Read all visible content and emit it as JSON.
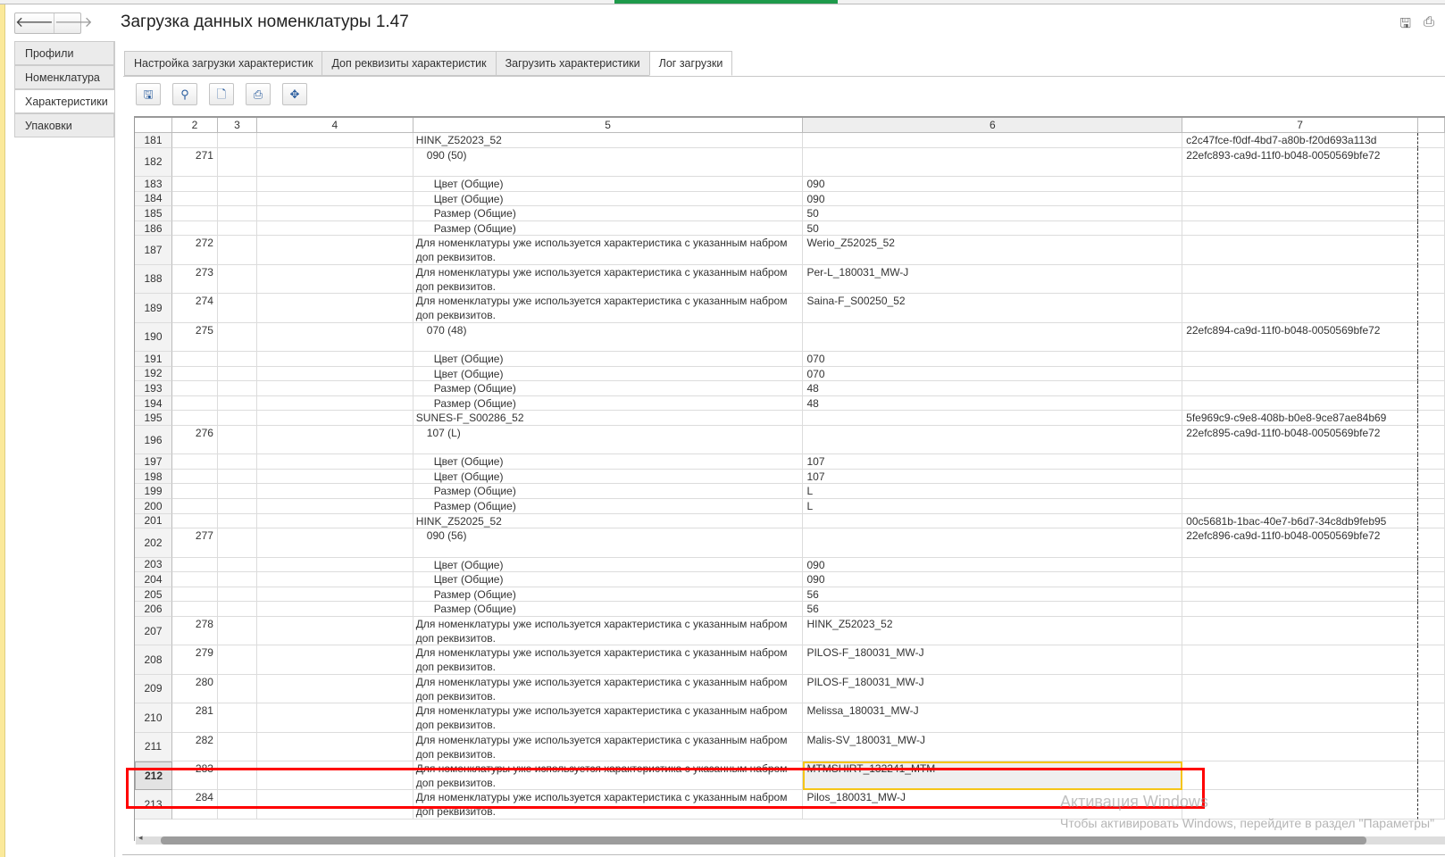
{
  "window": {
    "title": "Загрузка данных номенклатуры 1.47",
    "back": "🡐",
    "forward": "🡒"
  },
  "sidebar": {
    "items": [
      {
        "label": "Профили"
      },
      {
        "label": "Номенклатура"
      },
      {
        "label": "Характеристики"
      },
      {
        "label": "Упаковки"
      }
    ],
    "active": 2
  },
  "tabs": [
    {
      "label": "Настройка загрузки характеристик"
    },
    {
      "label": "Доп реквизиты характеристик"
    },
    {
      "label": "Загрузить характеристики"
    },
    {
      "label": "Лог загрузки"
    }
  ],
  "toolbar": {
    "icons": [
      "save-icon",
      "find-icon",
      "preview-icon",
      "print-icon",
      "move-icon"
    ]
  },
  "grid": {
    "headers": [
      "",
      "2",
      "3",
      "4",
      "5",
      "6",
      "7",
      ""
    ],
    "selected_row": "212",
    "rows": [
      {
        "n": "181",
        "c2": "",
        "c5": "HINK_Z52023_52",
        "i": 0,
        "c6": "",
        "c7": "c2c47fce-f0df-4bd7-a80b-f20d693a113d",
        "t": 0
      },
      {
        "n": "182",
        "c2": "271",
        "c5": "090 (50)",
        "i": 1,
        "c6": "",
        "c7": "22efc893-ca9d-11f0-b048-0050569bfe72",
        "t": 1
      },
      {
        "n": "183",
        "c2": "",
        "c5": "Цвет (Общие)",
        "i": 2,
        "c6": "090",
        "c7": "",
        "t": 0
      },
      {
        "n": "184",
        "c2": "",
        "c5": "Цвет (Общие)",
        "i": 2,
        "c6": "090",
        "c7": "",
        "t": 0
      },
      {
        "n": "185",
        "c2": "",
        "c5": "Размер (Общие)",
        "i": 2,
        "c6": "50",
        "c7": "",
        "t": 0
      },
      {
        "n": "186",
        "c2": "",
        "c5": "Размер (Общие)",
        "i": 2,
        "c6": "50",
        "c7": "",
        "t": 0
      },
      {
        "n": "187",
        "c2": "272",
        "c5": "Для номенклатуры уже используется характеристика с указанным набром доп реквизитов.",
        "i": 0,
        "c6": "Werio_Z52025_52",
        "c7": "",
        "t": 1
      },
      {
        "n": "188",
        "c2": "273",
        "c5": "Для номенклатуры уже используется характеристика с указанным набром доп реквизитов.",
        "i": 0,
        "c6": "Per-L_180031_MW-J",
        "c7": "",
        "t": 1
      },
      {
        "n": "189",
        "c2": "274",
        "c5": "Для номенклатуры уже используется характеристика с указанным набром доп реквизитов.",
        "i": 0,
        "c6": "Saina-F_S00250_52",
        "c7": "",
        "t": 1
      },
      {
        "n": "190",
        "c2": "275",
        "c5": "070 (48)",
        "i": 1,
        "c6": "",
        "c7": "22efc894-ca9d-11f0-b048-0050569bfe72",
        "t": 1
      },
      {
        "n": "191",
        "c2": "",
        "c5": "Цвет (Общие)",
        "i": 2,
        "c6": "070",
        "c7": "",
        "t": 0
      },
      {
        "n": "192",
        "c2": "",
        "c5": "Цвет (Общие)",
        "i": 2,
        "c6": "070",
        "c7": "",
        "t": 0
      },
      {
        "n": "193",
        "c2": "",
        "c5": "Размер (Общие)",
        "i": 2,
        "c6": "48",
        "c7": "",
        "t": 0
      },
      {
        "n": "194",
        "c2": "",
        "c5": "Размер (Общие)",
        "i": 2,
        "c6": "48",
        "c7": "",
        "t": 0
      },
      {
        "n": "195",
        "c2": "",
        "c5": "SUNES-F_S00286_52",
        "i": 0,
        "c6": "",
        "c7": "5fe969c9-c9e8-408b-b0e8-9ce87ae84b69",
        "t": 0
      },
      {
        "n": "196",
        "c2": "276",
        "c5": "107 (L)",
        "i": 1,
        "c6": "",
        "c7": "22efc895-ca9d-11f0-b048-0050569bfe72",
        "t": 1
      },
      {
        "n": "197",
        "c2": "",
        "c5": "Цвет (Общие)",
        "i": 2,
        "c6": "107",
        "c7": "",
        "t": 0
      },
      {
        "n": "198",
        "c2": "",
        "c5": "Цвет (Общие)",
        "i": 2,
        "c6": "107",
        "c7": "",
        "t": 0
      },
      {
        "n": "199",
        "c2": "",
        "c5": "Размер (Общие)",
        "i": 2,
        "c6": "L",
        "c7": "",
        "t": 0
      },
      {
        "n": "200",
        "c2": "",
        "c5": "Размер (Общие)",
        "i": 2,
        "c6": "L",
        "c7": "",
        "t": 0
      },
      {
        "n": "201",
        "c2": "",
        "c5": "HINK_Z52025_52",
        "i": 0,
        "c6": "",
        "c7": "00c5681b-1bac-40e7-b6d7-34c8db9feb95",
        "t": 0
      },
      {
        "n": "202",
        "c2": "277",
        "c5": "090 (56)",
        "i": 1,
        "c6": "",
        "c7": "22efc896-ca9d-11f0-b048-0050569bfe72",
        "t": 1
      },
      {
        "n": "203",
        "c2": "",
        "c5": "Цвет (Общие)",
        "i": 2,
        "c6": "090",
        "c7": "",
        "t": 0
      },
      {
        "n": "204",
        "c2": "",
        "c5": "Цвет (Общие)",
        "i": 2,
        "c6": "090",
        "c7": "",
        "t": 0
      },
      {
        "n": "205",
        "c2": "",
        "c5": "Размер (Общие)",
        "i": 2,
        "c6": "56",
        "c7": "",
        "t": 0
      },
      {
        "n": "206",
        "c2": "",
        "c5": "Размер (Общие)",
        "i": 2,
        "c6": "56",
        "c7": "",
        "t": 0
      },
      {
        "n": "207",
        "c2": "278",
        "c5": "Для номенклатуры уже используется характеристика с указанным набром доп реквизитов.",
        "i": 0,
        "c6": "HINK_Z52023_52",
        "c7": "",
        "t": 1
      },
      {
        "n": "208",
        "c2": "279",
        "c5": "Для номенклатуры уже используется характеристика с указанным набром доп реквизитов.",
        "i": 0,
        "c6": "PILOS-F_180031_MW-J",
        "c7": "",
        "t": 1
      },
      {
        "n": "209",
        "c2": "280",
        "c5": "Для номенклатуры уже используется характеристика с указанным набром доп реквизитов.",
        "i": 0,
        "c6": "PILOS-F_180031_MW-J",
        "c7": "",
        "t": 1
      },
      {
        "n": "210",
        "c2": "281",
        "c5": "Для номенклатуры уже используется характеристика с указанным набром доп реквизитов.",
        "i": 0,
        "c6": "Melissa_180031_MW-J",
        "c7": "",
        "t": 1
      },
      {
        "n": "211",
        "c2": "282",
        "c5": "Для номенклатуры уже используется характеристика с указанным набром доп реквизитов.",
        "i": 0,
        "c6": "Malis-SV_180031_MW-J",
        "c7": "",
        "t": 1
      },
      {
        "n": "212",
        "c2": "283",
        "c5": "Для номенклатуры уже используется характеристика с указанным набром доп реквизитов.",
        "i": 0,
        "c6": "MTMSHIRT_132241_MTM",
        "c7": "",
        "t": 1
      },
      {
        "n": "213",
        "c2": "284",
        "c5": "Для номенклатуры уже используется характеристика с указанным набром доп реквизитов.",
        "i": 0,
        "c6": "Pilos_180031_MW-J",
        "c7": "",
        "t": 1
      }
    ]
  },
  "watermark": {
    "title": "Активация Windows",
    "text": "Чтобы активировать Windows, перейдите в раздел \"Параметры\""
  },
  "colors": {
    "highlight_box": "#ff0000",
    "selected_cell_border": "#f5c518"
  }
}
